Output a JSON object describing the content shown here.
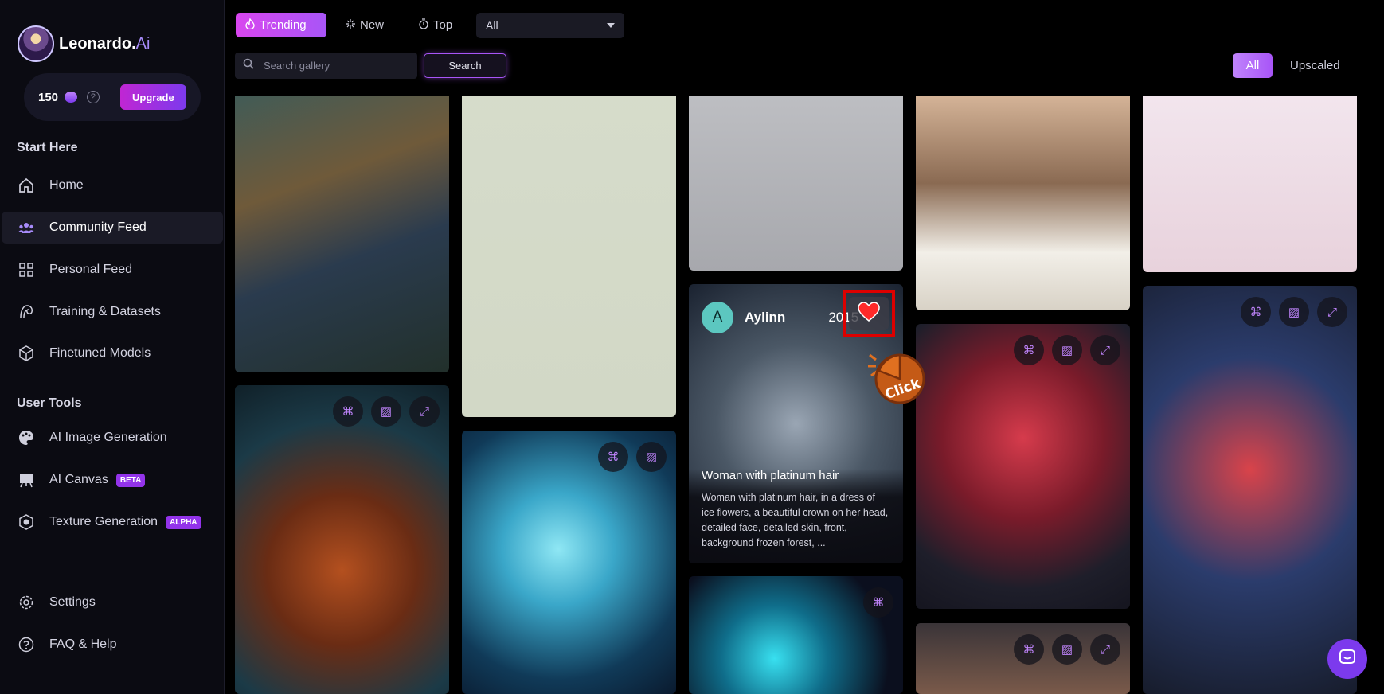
{
  "app": {
    "brand_main": "Leonardo.",
    "brand_ai": "Ai"
  },
  "credits": {
    "count": "150",
    "help": "?",
    "upgrade_label": "Upgrade"
  },
  "sidebar": {
    "section_start": "Start Here",
    "section_tools": "User Tools",
    "items": [
      {
        "label": "Home",
        "icon": "home-icon"
      },
      {
        "label": "Community Feed",
        "icon": "community-icon",
        "active": true
      },
      {
        "label": "Personal Feed",
        "icon": "grid-icon"
      },
      {
        "label": "Training & Datasets",
        "icon": "training-icon"
      },
      {
        "label": "Finetuned Models",
        "icon": "cube-icon"
      },
      {
        "label": "AI Image Generation",
        "icon": "palette-icon"
      },
      {
        "label": "AI Canvas",
        "icon": "canvas-icon",
        "badge": "BETA"
      },
      {
        "label": "Texture Generation",
        "icon": "texture-icon",
        "badge": "ALPHA"
      },
      {
        "label": "Settings",
        "icon": "gear-icon"
      },
      {
        "label": "FAQ & Help",
        "icon": "help-icon"
      }
    ]
  },
  "topbar": {
    "tabs": [
      {
        "label": "Trending",
        "icon": "flame-icon",
        "active": true
      },
      {
        "label": "New",
        "icon": "sparkle-icon"
      },
      {
        "label": "Top",
        "icon": "timer-icon"
      }
    ],
    "select_value": "All",
    "search_placeholder": "Search gallery",
    "search_button": "Search",
    "filter_all": "All",
    "filter_upscaled": "Upscaled"
  },
  "feed_card": {
    "user_initial": "A",
    "user_name": "Aylinn",
    "count": "2015",
    "title": "Woman with platinum hair",
    "description": "Woman with platinum hair, in a dress of ice flowers, a beautiful crown on her head, detailed face, detailed skin, front, background frozen forest, ..."
  },
  "annotation": {
    "click_label": "Click"
  },
  "colors": {
    "accent": "#a855f7",
    "brand_pink": "#d946ef",
    "highlight_red": "#dd0000"
  }
}
